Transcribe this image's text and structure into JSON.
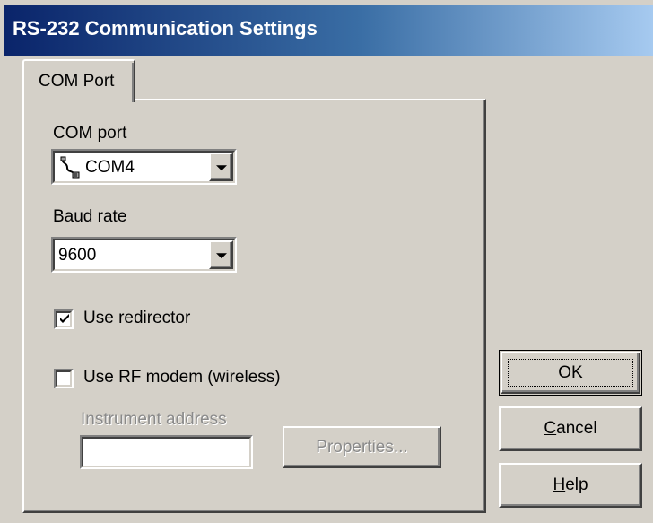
{
  "window": {
    "title": "RS-232 Communication Settings"
  },
  "tabs": [
    {
      "label": "COM Port",
      "selected": true
    }
  ],
  "com_port": {
    "label": "COM port",
    "value": "COM4",
    "icon": "serial-port-icon"
  },
  "baud_rate": {
    "label": "Baud rate",
    "value": "9600"
  },
  "use_redirector": {
    "label": "Use redirector",
    "checked": true
  },
  "use_rf_modem": {
    "label": "Use RF modem (wireless)",
    "checked": false
  },
  "instrument_address": {
    "label": "Instrument address",
    "value": "",
    "enabled": false
  },
  "buttons": {
    "properties": {
      "label": "Properties...",
      "enabled": false
    },
    "ok": {
      "label": "OK",
      "accel": "O",
      "rest": "K"
    },
    "cancel": {
      "label": "Cancel",
      "accel": "C",
      "rest": "ancel"
    },
    "help": {
      "label": "Help",
      "accel": "H",
      "rest": "elp"
    }
  },
  "colors": {
    "face": "#d4d0c8",
    "title_start": "#0a246a",
    "title_end": "#a6caf0",
    "disabled_text": "#8a8a8a"
  }
}
